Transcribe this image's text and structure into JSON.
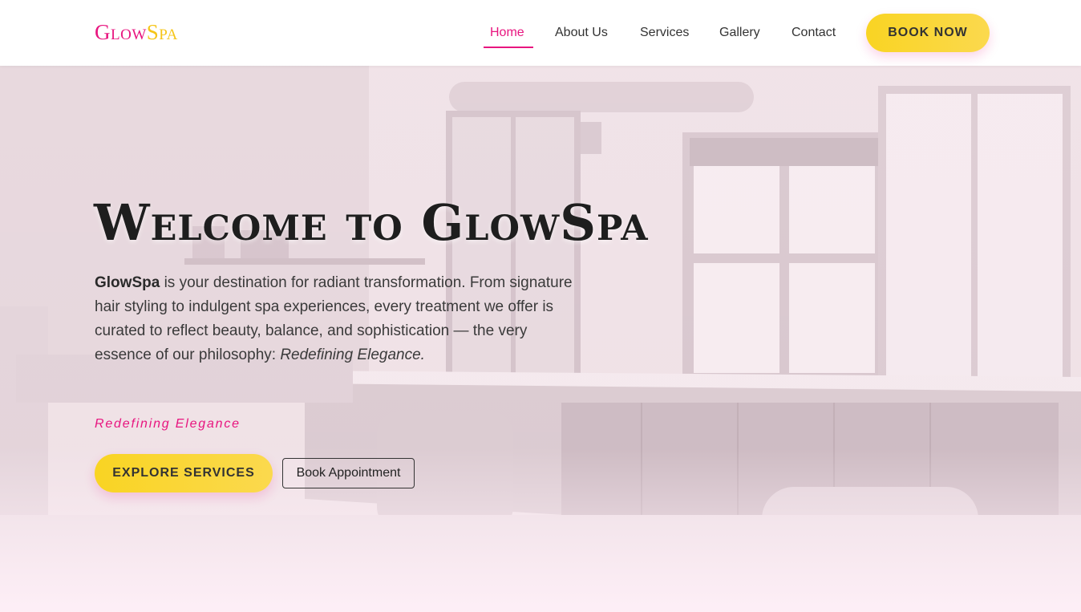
{
  "brand": {
    "logo_part1": "Glow",
    "logo_part2": "Spa"
  },
  "nav": {
    "items": [
      {
        "label": "Home",
        "active": true
      },
      {
        "label": "About Us"
      },
      {
        "label": "Services"
      },
      {
        "label": "Gallery"
      },
      {
        "label": "Contact"
      }
    ],
    "cta": "BOOK NOW"
  },
  "hero": {
    "title": "Welcome to GlowSpa",
    "text_brand": "GlowSpa",
    "text_body": " is your destination for radiant transformation. From signature hair styling to indulgent spa experiences, every treatment we offer is curated to reflect beauty, balance, and sophistication — the very essence of our philosophy: ",
    "text_emphasis": "Redefining Elegance.",
    "tagline": "Redefining Elegance",
    "primary_button": "EXPLORE SERVICES",
    "secondary_button": "Book Appointment"
  },
  "colors": {
    "accent_pink": "#e8157f",
    "accent_yellow": "#f9d423",
    "text_dark": "#1e1e1e"
  },
  "background": {
    "description_icon": "salon-interior-photo"
  }
}
